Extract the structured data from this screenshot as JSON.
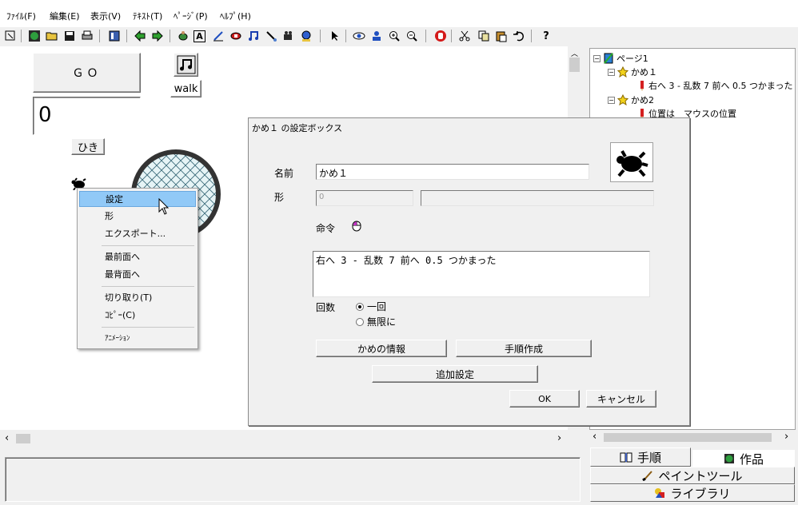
{
  "menu": [
    "ﾌｧｲﾙ(F)",
    "編集(E)",
    "表示(V)",
    "ﾃｷｽﾄ(T)",
    "ﾍﾟｰｼﾞ(P)",
    "ﾍﾙﾌﾟ(H)"
  ],
  "toolbar": {
    "text_icon": "A",
    "help_icon": "?"
  },
  "stage": {
    "go_button": "ＧＯ",
    "counter_value": "0",
    "counter_label": "ひき",
    "walk_label": "walk"
  },
  "context_menu": {
    "items": [
      "設定",
      "形",
      "エクスポート...",
      "最前面へ",
      "最背面へ",
      "切り取り(T)",
      "ｺﾋﾟｰ(C)",
      "ｱﾆﾒｰｼｮﾝ"
    ]
  },
  "dialog": {
    "title": "かめ１ の設定ボックス",
    "name_label": "名前",
    "name_value": "かめ１",
    "shape_label": "形",
    "shape_value": "0",
    "command_label": "命令",
    "command_text": "右へ 3 - 乱数 7 前へ 0.5 つかまった",
    "count_label": "回数",
    "radio_once": "一回",
    "radio_infinite": "無限に",
    "info_button": "かめの情報",
    "procedure_button": "手順作成",
    "extra_button": "追加設定",
    "ok_button": "OK",
    "cancel_button": "キャンセル"
  },
  "tree": {
    "page": "ページ1",
    "turtle1": "かめ１",
    "turtle1_cmd": "右へ 3 - 乱数 7 前へ 0.5 つかまった",
    "turtle2": "かめ2",
    "turtle2_cmd": "位置は　マウスの位置"
  },
  "tabs": {
    "procedure": "手順",
    "works": "作品",
    "paint": "ペイントツール",
    "library": "ライブラリ"
  }
}
